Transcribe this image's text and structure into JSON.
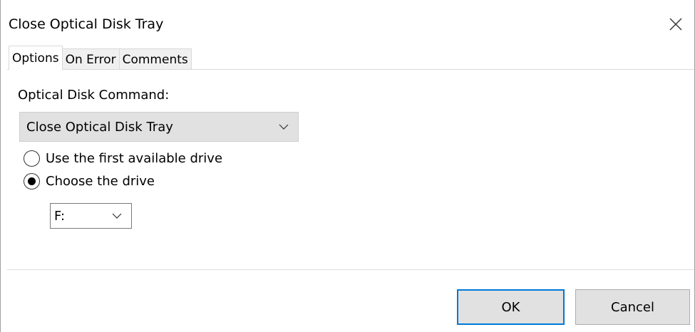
{
  "window": {
    "title": "Close Optical Disk Tray",
    "close_icon": "close-icon"
  },
  "tabs": [
    {
      "label": "Options",
      "active": true
    },
    {
      "label": "On Error",
      "active": false
    },
    {
      "label": "Comments",
      "active": false
    }
  ],
  "options": {
    "command_label": "Optical Disk Command:",
    "command_value": "Close Optical Disk Tray",
    "radio_first_drive": {
      "label": "Use the first available drive",
      "checked": false
    },
    "radio_choose_drive": {
      "label": "Choose the drive",
      "checked": true
    },
    "drive_value": "F:"
  },
  "buttons": {
    "ok": "OK",
    "cancel": "Cancel"
  },
  "colors": {
    "focus_accent": "#0078d7",
    "button_face": "#e1e1e1"
  }
}
